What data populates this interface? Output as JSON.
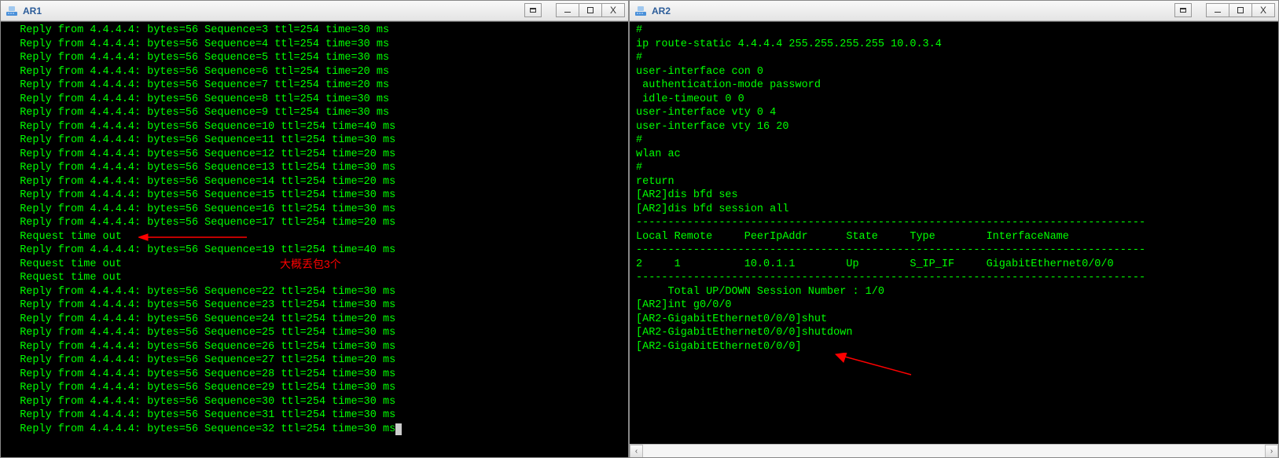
{
  "ar1": {
    "title": "AR1",
    "lines": [
      "  Reply from 4.4.4.4: bytes=56 Sequence=3 ttl=254 time=30 ms",
      "  Reply from 4.4.4.4: bytes=56 Sequence=4 ttl=254 time=30 ms",
      "  Reply from 4.4.4.4: bytes=56 Sequence=5 ttl=254 time=30 ms",
      "  Reply from 4.4.4.4: bytes=56 Sequence=6 ttl=254 time=20 ms",
      "  Reply from 4.4.4.4: bytes=56 Sequence=7 ttl=254 time=20 ms",
      "  Reply from 4.4.4.4: bytes=56 Sequence=8 ttl=254 time=30 ms",
      "  Reply from 4.4.4.4: bytes=56 Sequence=9 ttl=254 time=30 ms",
      "  Reply from 4.4.4.4: bytes=56 Sequence=10 ttl=254 time=40 ms",
      "  Reply from 4.4.4.4: bytes=56 Sequence=11 ttl=254 time=30 ms",
      "  Reply from 4.4.4.4: bytes=56 Sequence=12 ttl=254 time=20 ms",
      "  Reply from 4.4.4.4: bytes=56 Sequence=13 ttl=254 time=30 ms",
      "  Reply from 4.4.4.4: bytes=56 Sequence=14 ttl=254 time=20 ms",
      "  Reply from 4.4.4.4: bytes=56 Sequence=15 ttl=254 time=30 ms",
      "  Reply from 4.4.4.4: bytes=56 Sequence=16 ttl=254 time=30 ms",
      "  Reply from 4.4.4.4: bytes=56 Sequence=17 ttl=254 time=20 ms",
      "  Request time out",
      "  Reply from 4.4.4.4: bytes=56 Sequence=19 ttl=254 time=40 ms",
      "  Request time out",
      "  Request time out",
      "  Reply from 4.4.4.4: bytes=56 Sequence=22 ttl=254 time=30 ms",
      "  Reply from 4.4.4.4: bytes=56 Sequence=23 ttl=254 time=30 ms",
      "  Reply from 4.4.4.4: bytes=56 Sequence=24 ttl=254 time=20 ms",
      "  Reply from 4.4.4.4: bytes=56 Sequence=25 ttl=254 time=30 ms",
      "  Reply from 4.4.4.4: bytes=56 Sequence=26 ttl=254 time=30 ms",
      "  Reply from 4.4.4.4: bytes=56 Sequence=27 ttl=254 time=20 ms",
      "  Reply from 4.4.4.4: bytes=56 Sequence=28 ttl=254 time=30 ms",
      "  Reply from 4.4.4.4: bytes=56 Sequence=29 ttl=254 time=30 ms",
      "  Reply from 4.4.4.4: bytes=56 Sequence=30 ttl=254 time=30 ms",
      "  Reply from 4.4.4.4: bytes=56 Sequence=31 ttl=254 time=30 ms",
      "  Reply from 4.4.4.4: bytes=56 Sequence=32 ttl=254 time=30 ms"
    ],
    "annotation_text": "大概丢包3个"
  },
  "ar2": {
    "title": "AR2",
    "lines": [
      "#",
      "ip route-static 4.4.4.4 255.255.255.255 10.0.3.4",
      "#",
      "user-interface con 0",
      " authentication-mode password",
      " idle-timeout 0 0",
      "user-interface vty 0 4",
      "user-interface vty 16 20",
      "#",
      "wlan ac",
      "#",
      "return",
      "[AR2]dis bfd ses",
      "[AR2]dis bfd session all",
      "--------------------------------------------------------------------------------",
      "Local Remote     PeerIpAddr      State     Type        InterfaceName",
      "--------------------------------------------------------------------------------",
      "",
      "2     1          10.0.1.1        Up        S_IP_IF     GigabitEthernet0/0/0",
      "--------------------------------------------------------------------------------",
      "     Total UP/DOWN Session Number : 1/0",
      "[AR2]int g0/0/0",
      "[AR2-GigabitEthernet0/0/0]shut",
      "[AR2-GigabitEthernet0/0/0]shutdown",
      "[AR2-GigabitEthernet0/0/0]"
    ]
  },
  "colors": {
    "term_fg": "#00ff00",
    "term_bg": "#000000",
    "annotation": "#ff0000",
    "title_fg": "#2b5c99"
  }
}
